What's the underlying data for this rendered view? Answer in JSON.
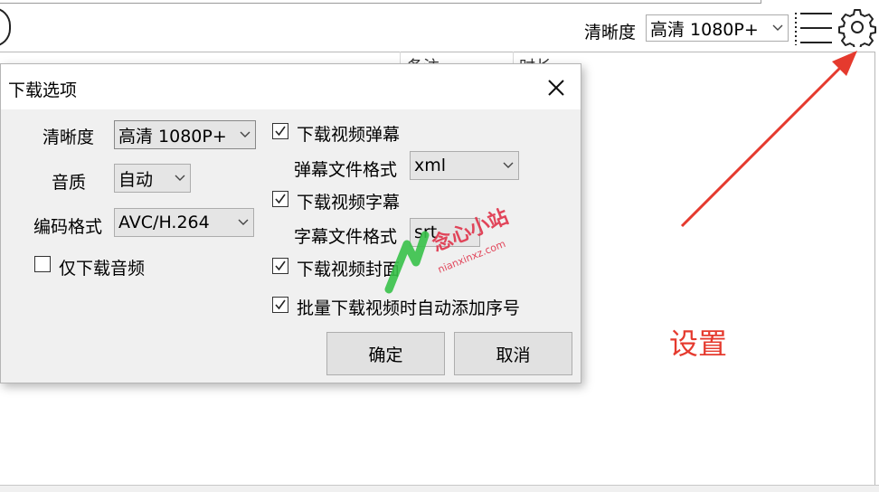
{
  "toolbar": {
    "quality_label": "清晰度",
    "quality_value": "高清 1080P+",
    "menu_icon": "menu-list-icon",
    "settings_icon": "gear-icon"
  },
  "table": {
    "columns": [
      "备注",
      "时长"
    ]
  },
  "dialog": {
    "title": "下载选项",
    "close_icon": "close-icon",
    "quality_label": "清晰度",
    "quality_value": "高清 1080P+",
    "audio_label": "音质",
    "audio_value": "自动",
    "codec_label": "编码格式",
    "codec_value": "AVC/H.264",
    "audio_only": {
      "label": "仅下载音频",
      "checked": false
    },
    "danmaku": {
      "label": "下载视频弹幕",
      "checked": true
    },
    "danmaku_format_label": "弹幕文件格式",
    "danmaku_format_value": "xml",
    "subtitle": {
      "label": "下载视频字幕",
      "checked": true
    },
    "subtitle_format_label": "字幕文件格式",
    "subtitle_format_value": "srt",
    "cover": {
      "label": "下载视频封面",
      "checked": true
    },
    "batch_number": {
      "label": "批量下载视频时自动添加序号",
      "checked": true
    },
    "ok_button": "确定",
    "cancel_button": "取消"
  },
  "annotation": {
    "note": "设置",
    "color": "#e53a2e"
  },
  "watermark": {
    "title": "念心小站",
    "url": "nianxinxz.com"
  }
}
